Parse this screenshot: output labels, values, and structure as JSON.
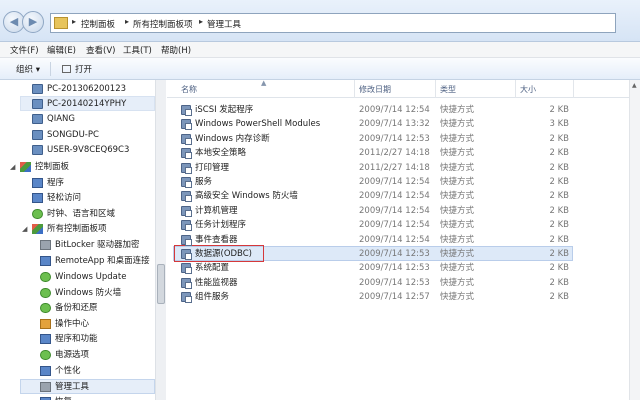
{
  "address": {
    "crumbs": [
      "控制面板",
      "所有控制面板项",
      "管理工具"
    ],
    "separator": "▸"
  },
  "menubar": {
    "items": [
      "文件(F)",
      "编辑(E)",
      "查看(V)",
      "工具(T)",
      "帮助(H)"
    ]
  },
  "toolbar": {
    "organize_label": "组织 ▾",
    "open_label": "打开"
  },
  "nav": {
    "computers": [
      "PC-201306200123",
      "PC-20140214YPHY",
      "QIANG",
      "SONGDU-PC",
      "USER-9V8CEQ69C3"
    ],
    "control_panel": "控制面板",
    "cp_children": [
      "程序",
      "轻松访问",
      "时钟、语言和区域",
      "所有控制面板项"
    ],
    "all_items": [
      "BitLocker 驱动器加密",
      "RemoteApp 和桌面连接",
      "Windows Update",
      "Windows 防火墙",
      "备份和还原",
      "操作中心",
      "程序和功能",
      "电源选项",
      "个性化",
      "管理工具",
      "恢复"
    ]
  },
  "columns": {
    "name": "名称",
    "date": "修改日期",
    "type": "类型",
    "size": "大小"
  },
  "files": [
    {
      "name": "iSCSI 发起程序",
      "date": "2009/7/14 12:54",
      "type": "快捷方式",
      "size": "2 KB"
    },
    {
      "name": "Windows PowerShell Modules",
      "date": "2009/7/14 13:32",
      "type": "快捷方式",
      "size": "3 KB"
    },
    {
      "name": "Windows 内存诊断",
      "date": "2009/7/14 12:53",
      "type": "快捷方式",
      "size": "2 KB"
    },
    {
      "name": "本地安全策略",
      "date": "2011/2/27 14:18",
      "type": "快捷方式",
      "size": "2 KB"
    },
    {
      "name": "打印管理",
      "date": "2011/2/27 14:18",
      "type": "快捷方式",
      "size": "2 KB"
    },
    {
      "name": "服务",
      "date": "2009/7/14 12:54",
      "type": "快捷方式",
      "size": "2 KB"
    },
    {
      "name": "高级安全 Windows 防火墙",
      "date": "2009/7/14 12:54",
      "type": "快捷方式",
      "size": "2 KB"
    },
    {
      "name": "计算机管理",
      "date": "2009/7/14 12:54",
      "type": "快捷方式",
      "size": "2 KB"
    },
    {
      "name": "任务计划程序",
      "date": "2009/7/14 12:54",
      "type": "快捷方式",
      "size": "2 KB"
    },
    {
      "name": "事件查看器",
      "date": "2009/7/14 12:54",
      "type": "快捷方式",
      "size": "2 KB"
    },
    {
      "name": "数据源(ODBC)",
      "date": "2009/7/14 12:53",
      "type": "快捷方式",
      "size": "2 KB"
    },
    {
      "name": "系统配置",
      "date": "2009/7/14 12:53",
      "type": "快捷方式",
      "size": "2 KB"
    },
    {
      "name": "性能监视器",
      "date": "2009/7/14 12:53",
      "type": "快捷方式",
      "size": "2 KB"
    },
    {
      "name": "组件服务",
      "date": "2009/7/14 12:57",
      "type": "快捷方式",
      "size": "2 KB"
    }
  ],
  "selected_file_index": 10,
  "selected_nav": "管理工具",
  "colors": {
    "selection": "#dde9f8",
    "highlight_box": "#d5383a"
  }
}
